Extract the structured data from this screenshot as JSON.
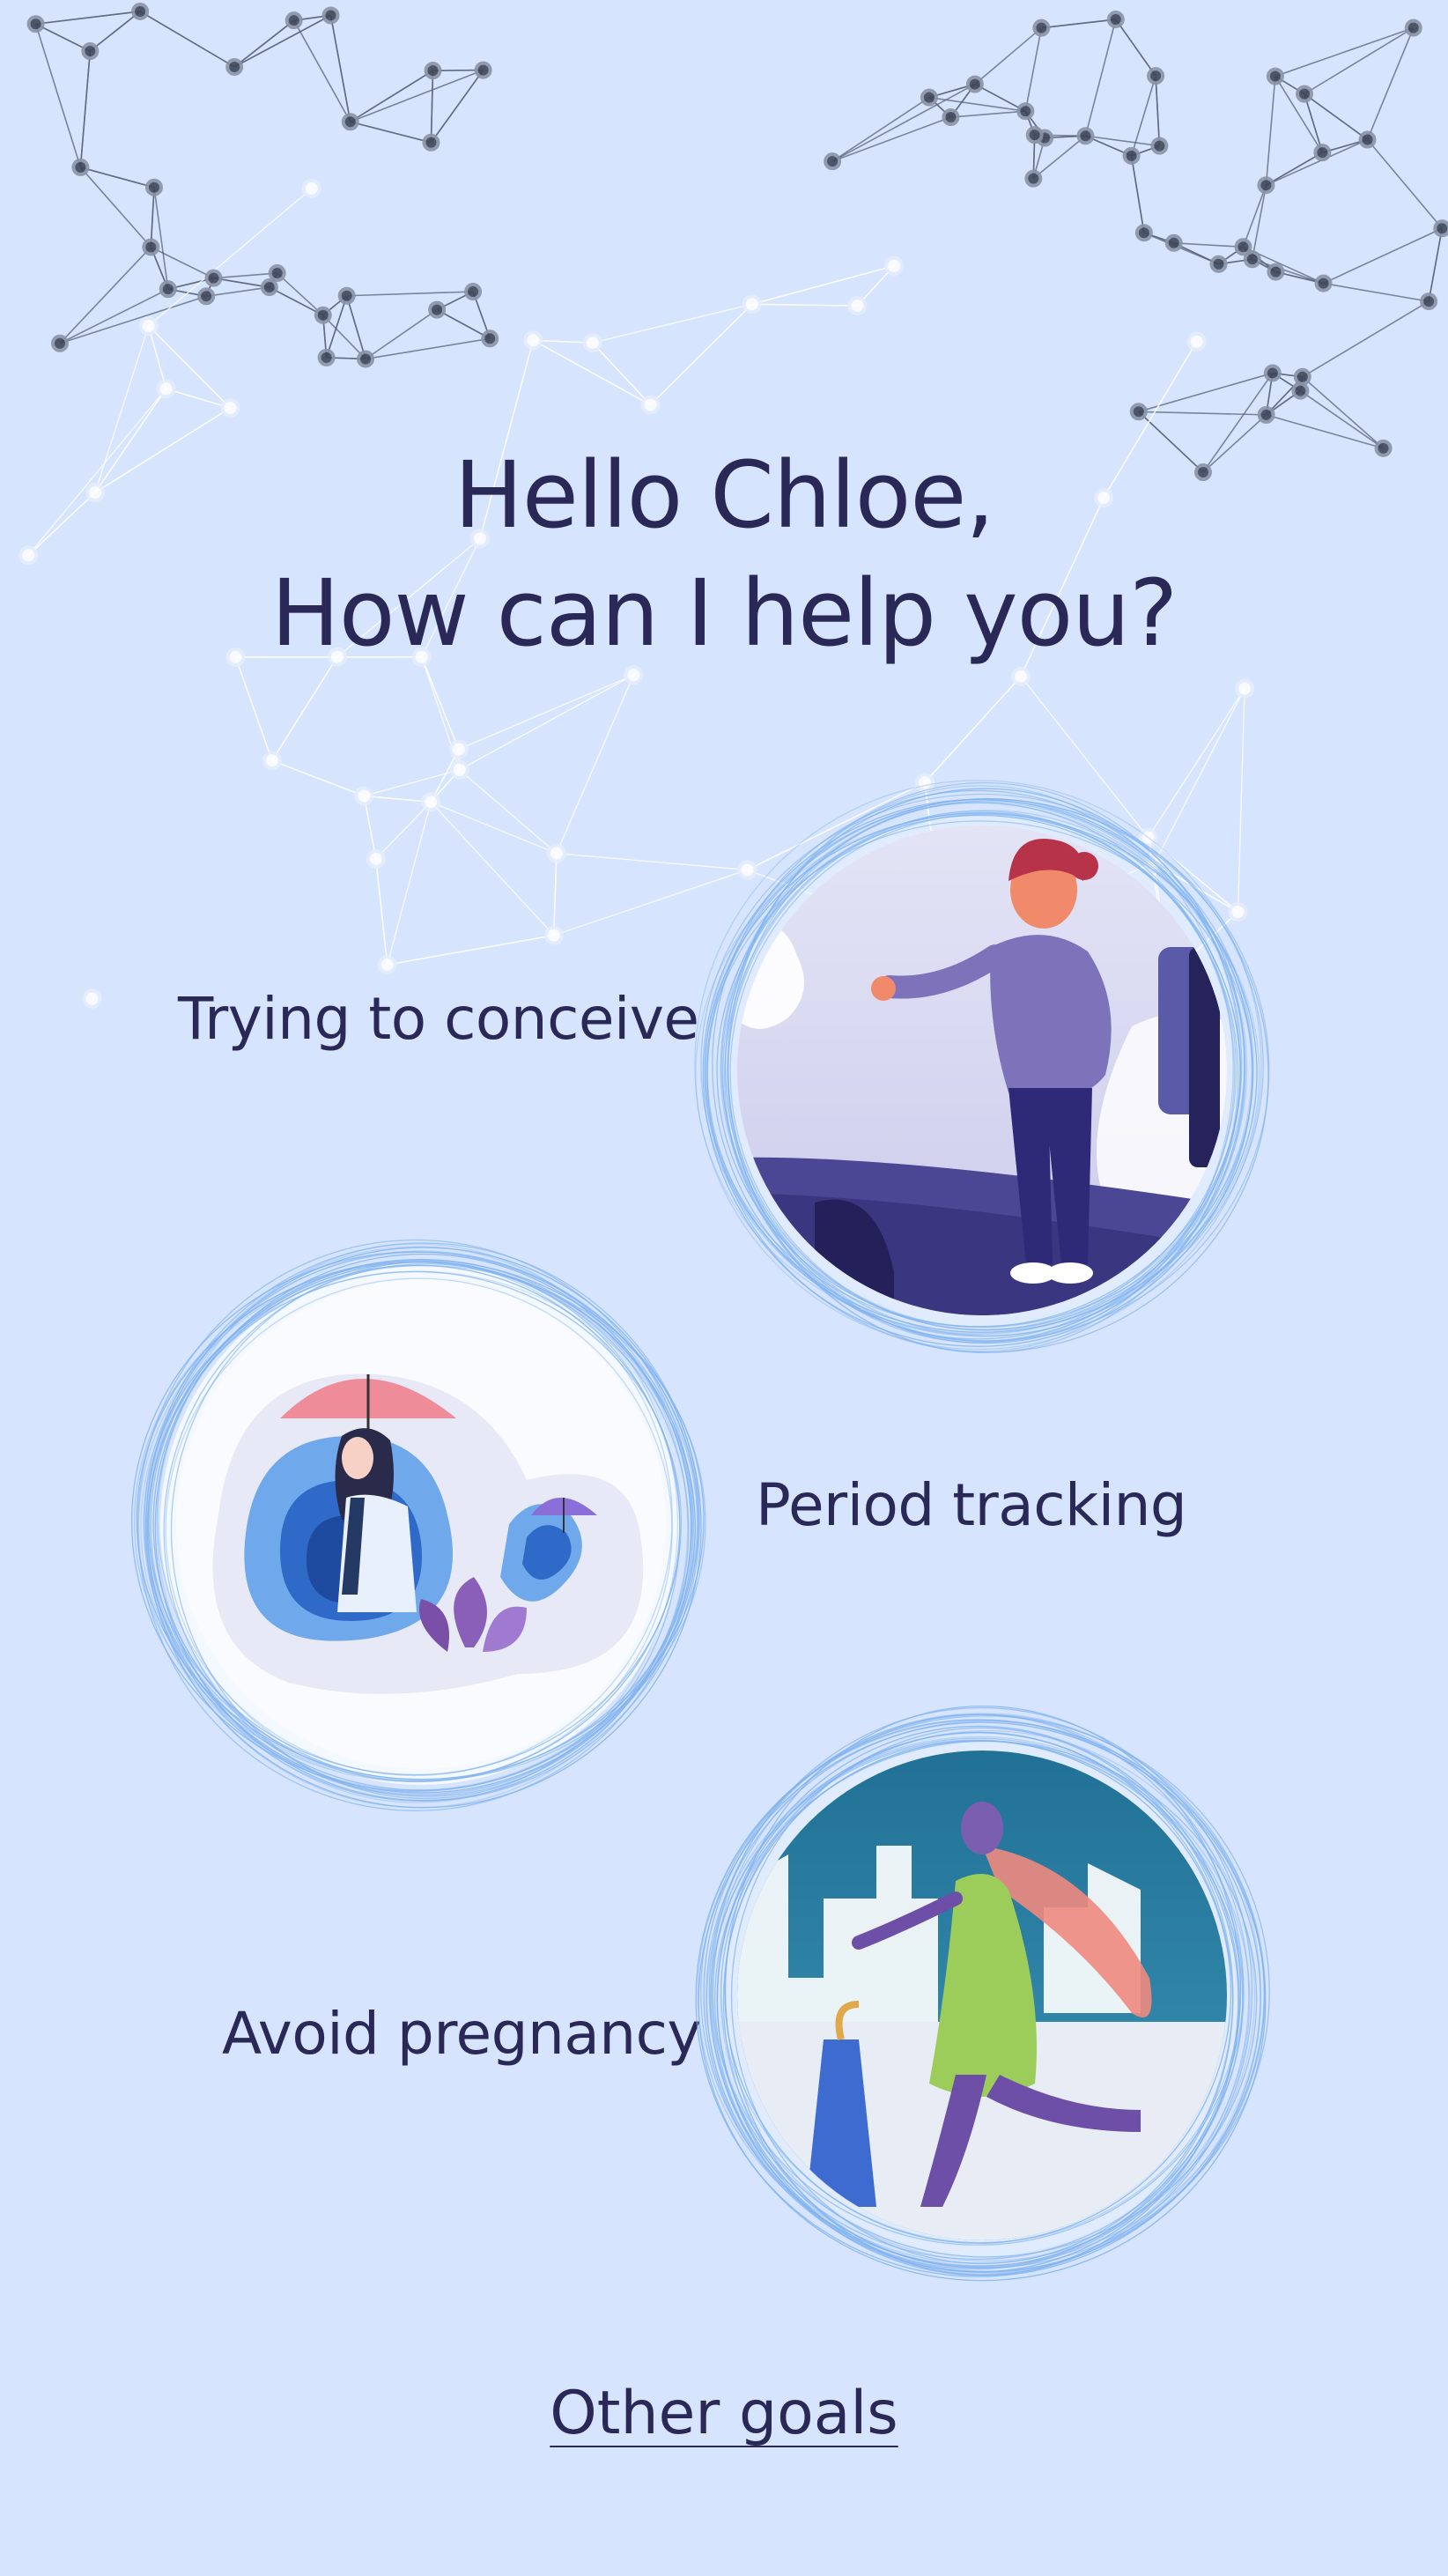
{
  "greeting": {
    "line1": "Hello Chloe,",
    "line2": "How can I help you?"
  },
  "goals": [
    {
      "label": "Trying to conceive",
      "illustration": "pregnant-woman-illustration"
    },
    {
      "label": "Period tracking",
      "illustration": "woman-with-umbrella-illustration"
    },
    {
      "label": "Avoid pregnancy",
      "illustration": "woman-walking-city-illustration"
    }
  ],
  "footer": {
    "other_goals_label": "Other goals"
  },
  "colors": {
    "background": "#d6e4fd",
    "text": "#2a2857",
    "ring": "#7fb2ee",
    "network_dark": "#5b6478",
    "network_light": "#ffffff"
  }
}
